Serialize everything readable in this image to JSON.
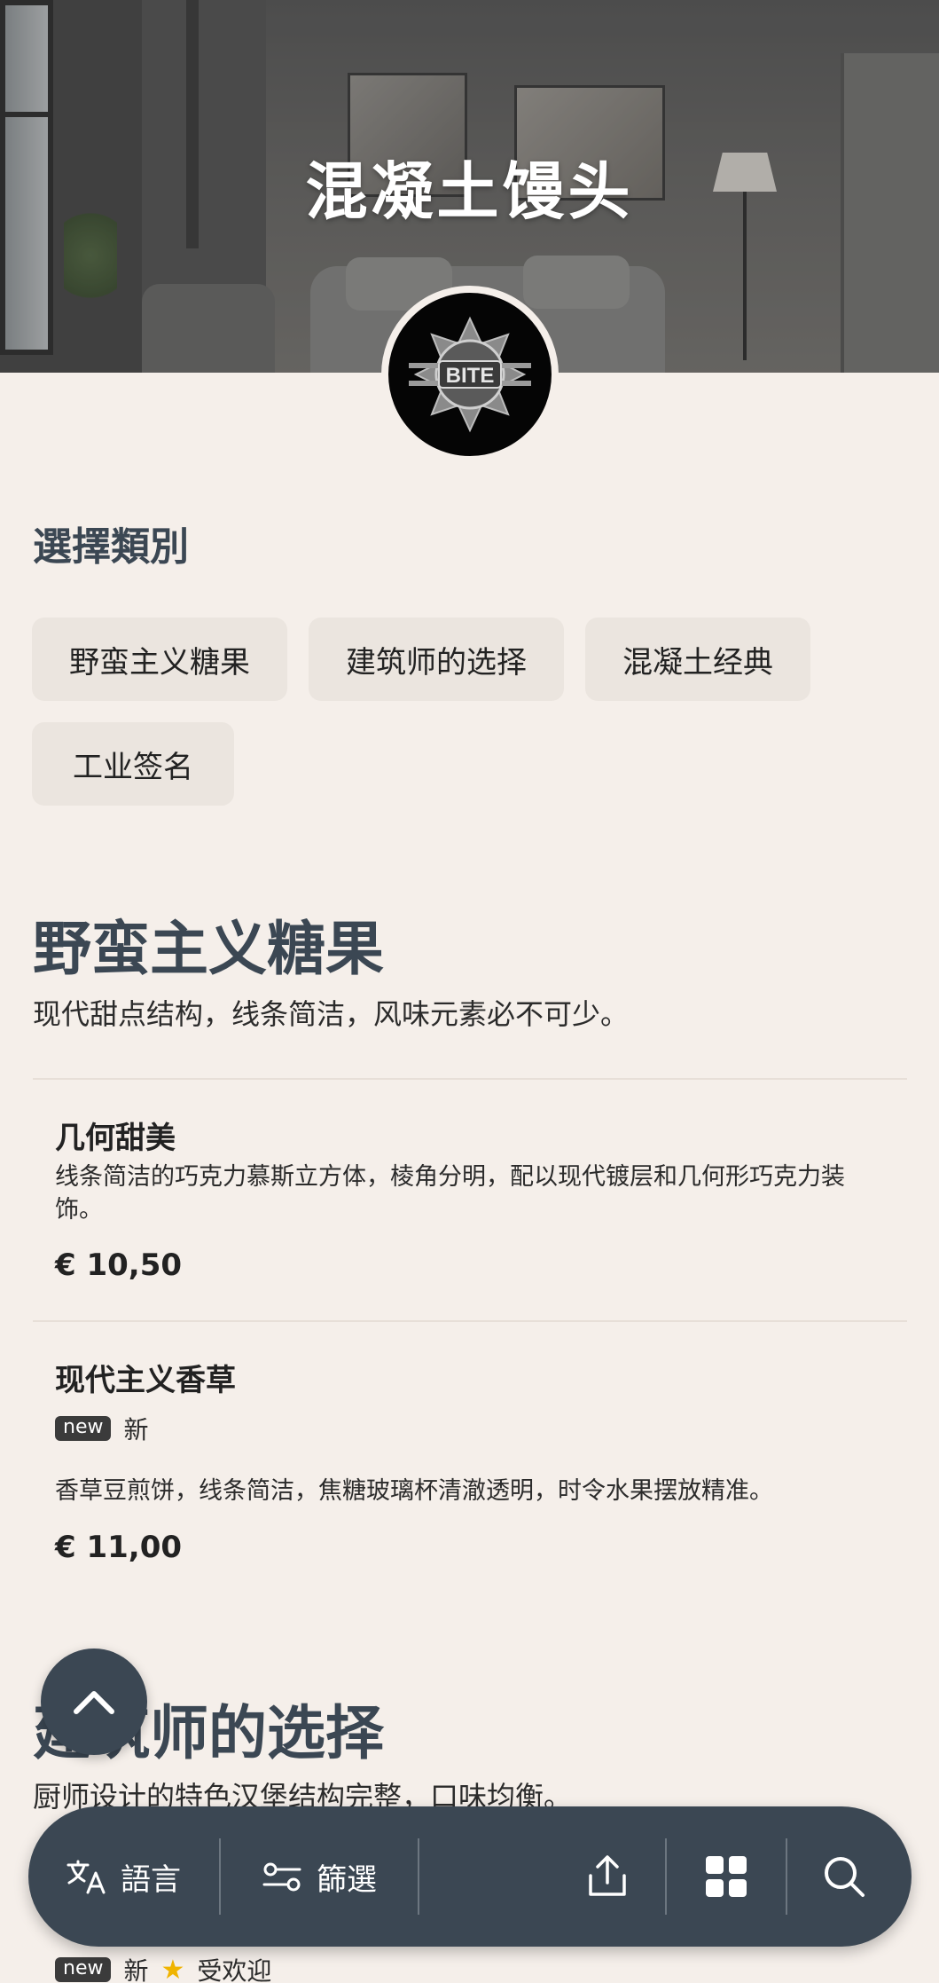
{
  "header": {
    "title": "混凝土馒头"
  },
  "categories_section": {
    "label": "選擇類別",
    "chips": [
      "野蛮主义糖果",
      "建筑师的选择",
      "混凝土经典",
      "工业签名"
    ]
  },
  "menu": {
    "sections": [
      {
        "title": "野蛮主义糖果",
        "description": "现代甜点结构，线条简洁，风味元素必不可少。",
        "items": [
          {
            "name": "几何甜美",
            "description": "线条简洁的巧克力慕斯立方体，棱角分明，配以现代镀层和几何形巧克力装饰。",
            "price": "€ 10,50"
          },
          {
            "name": "现代主义香草",
            "badge": "new",
            "badge_label": "新",
            "description": "香草豆煎饼，线条简洁，焦糖玻璃杯清澈透明，时令水果摆放精准。",
            "price": "€ 11,00"
          }
        ]
      },
      {
        "title": "建筑师的选择",
        "description": "厨师设计的特色汉堡结构完整，口味均衡。",
        "items": [
          {
            "badge": "new",
            "badge_label": "新",
            "popular_label": "受欢迎"
          }
        ]
      }
    ]
  },
  "bottom_bar": {
    "language_label": "語言",
    "filter_label": "篩選"
  },
  "icons": {
    "language": "translate-icon",
    "filter": "filter-icon",
    "share": "share-icon",
    "grid": "grid-icon",
    "search": "search-icon",
    "back_to_top": "chevron-up-icon"
  },
  "colors": {
    "background": "#f5efea",
    "accent": "#3b4753",
    "chip": "#ebe5df",
    "star": "#f0b400"
  }
}
